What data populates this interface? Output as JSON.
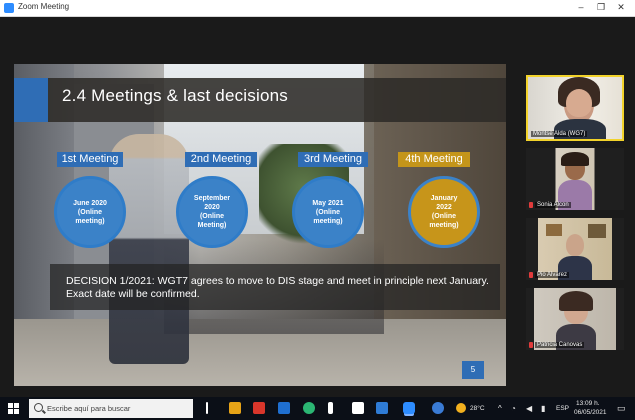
{
  "window": {
    "title": "Zoom Meeting"
  },
  "slide": {
    "title": "2.4 Meetings & last decisions",
    "meetings": [
      {
        "label": "1st Meeting",
        "circle": "June 2020\n(Online\nmeeting)",
        "color": "#3b82c8"
      },
      {
        "label": "2nd Meeting",
        "circle": "September\n2020\n(Online\nMeeting)",
        "color": "#3b82c8"
      },
      {
        "label": "3rd Meeting",
        "circle": "May 2021\n(Online\nmeeting)",
        "color": "#3b82c8"
      },
      {
        "label": "4th Meeting",
        "circle": "January\n2022\n(Online\nmeeting)",
        "color": "#c7951a"
      }
    ],
    "decision": "DECISION 1/2021: WGT7 agrees to move to DIS stage and meet in principle next January. Exact date will be confirmed.",
    "page_number": "5"
  },
  "participants": [
    {
      "name": "Montse Alda (WG7)",
      "muted": false,
      "active": true
    },
    {
      "name": "Sonia Alcon",
      "muted": true,
      "active": false
    },
    {
      "name": "Pio Alvarez",
      "muted": true,
      "active": false
    },
    {
      "name": "Patricia Canovas",
      "muted": true,
      "active": false
    }
  ],
  "taskbar": {
    "search_placeholder": "Escribe aquí para buscar",
    "temperature": "28°C",
    "time": "13:09 h.",
    "date": "06/05/2021",
    "language": "ESP"
  },
  "colors": {
    "accent_blue": "#2f6db5",
    "accent_gold": "#c4951a",
    "active_speaker": "#f2d32b"
  }
}
